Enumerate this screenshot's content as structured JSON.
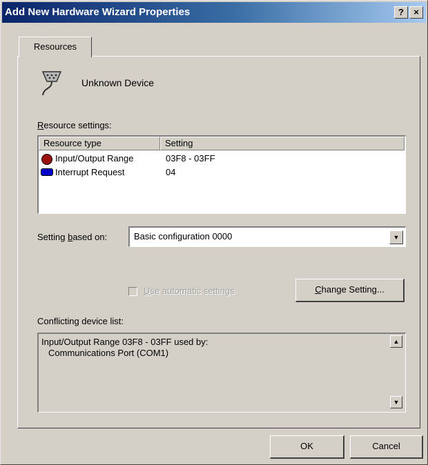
{
  "window": {
    "title": "Add New Hardware Wizard Properties",
    "help_button": "?",
    "close_button": "×"
  },
  "tabs": [
    {
      "label": "Resources",
      "selected": true
    }
  ],
  "device": {
    "name": "Unknown Device",
    "icon": "serial-port-icon"
  },
  "resource_settings": {
    "label_mnemonic": "R",
    "label_rest": "esource settings:",
    "columns": [
      "Resource type",
      "Setting"
    ],
    "rows": [
      {
        "type": "Input/Output Range",
        "setting": "03F8 - 03FF",
        "icon": "io-range-icon",
        "icon_color": "#9a1010"
      },
      {
        "type": "Interrupt Request",
        "setting": "04",
        "icon": "irq-icon",
        "icon_color": "#0000c8"
      }
    ]
  },
  "setting_based_on": {
    "label_pre": "Setting ",
    "label_mnemonic": "b",
    "label_post": "ased on:",
    "value": "Basic configuration 0000",
    "dropdown_arrow": "▼"
  },
  "automatic": {
    "checked": false,
    "label_mnemonic": "U",
    "label_rest": "se automatic settings",
    "enabled": false
  },
  "change_setting": {
    "mnemonic": "C",
    "rest": "hange Setting..."
  },
  "conflicts": {
    "label": "Conflicting device list:",
    "line1": "Input/Output Range 03F8 - 03FF used by:",
    "line2": "Communications Port (COM1)",
    "scroll_up": "▲",
    "scroll_down": "▼"
  },
  "buttons": {
    "ok": "OK",
    "cancel": "Cancel"
  },
  "colors": {
    "title_start": "#0a246a",
    "title_end": "#a6caf0",
    "face": "#d4d0c8"
  }
}
